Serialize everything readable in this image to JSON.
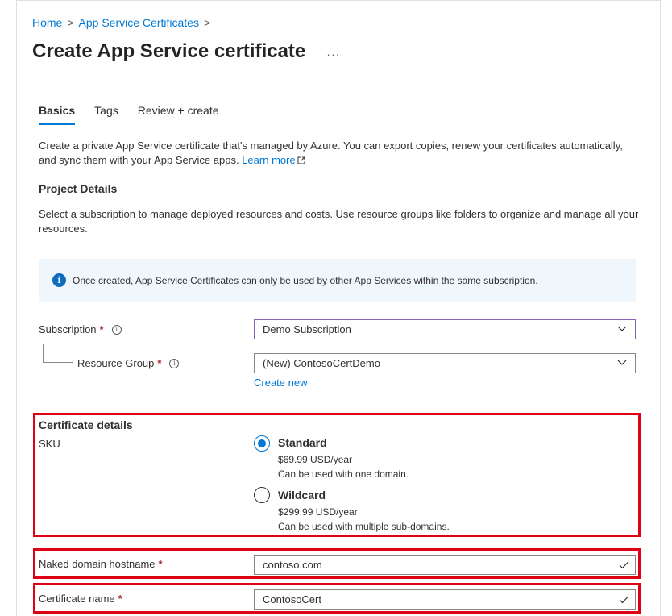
{
  "breadcrumb": {
    "home": "Home",
    "sep1": ">",
    "parent": "App Service Certificates",
    "sep2": ">"
  },
  "page": {
    "title": "Create App Service certificate",
    "more": "···"
  },
  "tabs": [
    {
      "label": "Basics",
      "active": true
    },
    {
      "label": "Tags",
      "active": false
    },
    {
      "label": "Review + create",
      "active": false
    }
  ],
  "intro": {
    "text": "Create a private App Service certificate that's managed by Azure. You can export copies, renew your certificates automatically, and sync them with your App Service apps.",
    "link": "Learn more"
  },
  "project_details": {
    "heading": "Project Details",
    "description": "Select a subscription to manage deployed resources and costs. Use resource groups like folders to organize and manage all your resources."
  },
  "info_bar": {
    "icon": "info-icon",
    "text": "Once created, App Service Certificates can only be used by other App Services within the same subscription."
  },
  "subscription": {
    "label": "Subscription",
    "required": "*",
    "tooltip": "i",
    "value": "Demo Subscription"
  },
  "resource_group": {
    "label": "Resource Group",
    "required": "*",
    "tooltip": "i",
    "value": "(New) ContosoCertDemo",
    "create_new": "Create new"
  },
  "certificate_details": {
    "heading": "Certificate details",
    "sku_label": "SKU",
    "options": [
      {
        "title": "Standard",
        "price": "$69.99 USD/year",
        "desc": "Can be used with one domain.",
        "selected": true
      },
      {
        "title": "Wildcard",
        "price": "$299.99 USD/year",
        "desc": "Can be used with multiple sub-domains.",
        "selected": false
      }
    ]
  },
  "hostname": {
    "label": "Naked domain hostname",
    "required": "*",
    "value": "contoso.com"
  },
  "cert_name": {
    "label": "Certificate name",
    "required": "*",
    "value": "ContosoCert"
  },
  "colors": {
    "accent": "#0078d4",
    "highlight": "#e00016",
    "info_bg": "#eff6fc"
  }
}
